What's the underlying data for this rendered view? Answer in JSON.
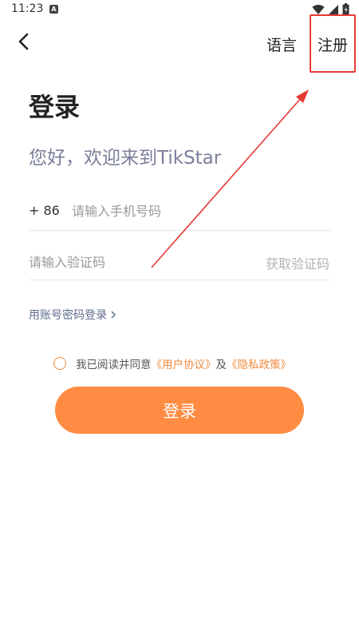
{
  "status_bar": {
    "time": "11:23",
    "app_icon_letter": "A"
  },
  "nav": {
    "language_label": "语言",
    "register_label": "注册"
  },
  "title": "登录",
  "welcome": "您好，欢迎来到TikStar",
  "phone": {
    "country_code": "+ 86",
    "placeholder": "请输入手机号码",
    "value": ""
  },
  "code": {
    "placeholder": "请输入验证码",
    "value": "",
    "get_code_label": "获取验证码"
  },
  "password_login_link": "用账号密码登录",
  "agreement": {
    "checked": false,
    "prefix": "我已阅读并同意",
    "user_agreement": "《用户协议》",
    "conjunction": "及",
    "privacy_policy": "《隐私政策》"
  },
  "login_button": "登录",
  "colors": {
    "accent": "#ff8c42",
    "annotation": "#e53935",
    "welcome_text": "#7a7f9a"
  },
  "icons": {
    "back": "chevron-left-icon",
    "wifi": "wifi-icon",
    "signal": "signal-icon",
    "battery": "battery-icon",
    "chevron": "chevron-right-icon"
  }
}
